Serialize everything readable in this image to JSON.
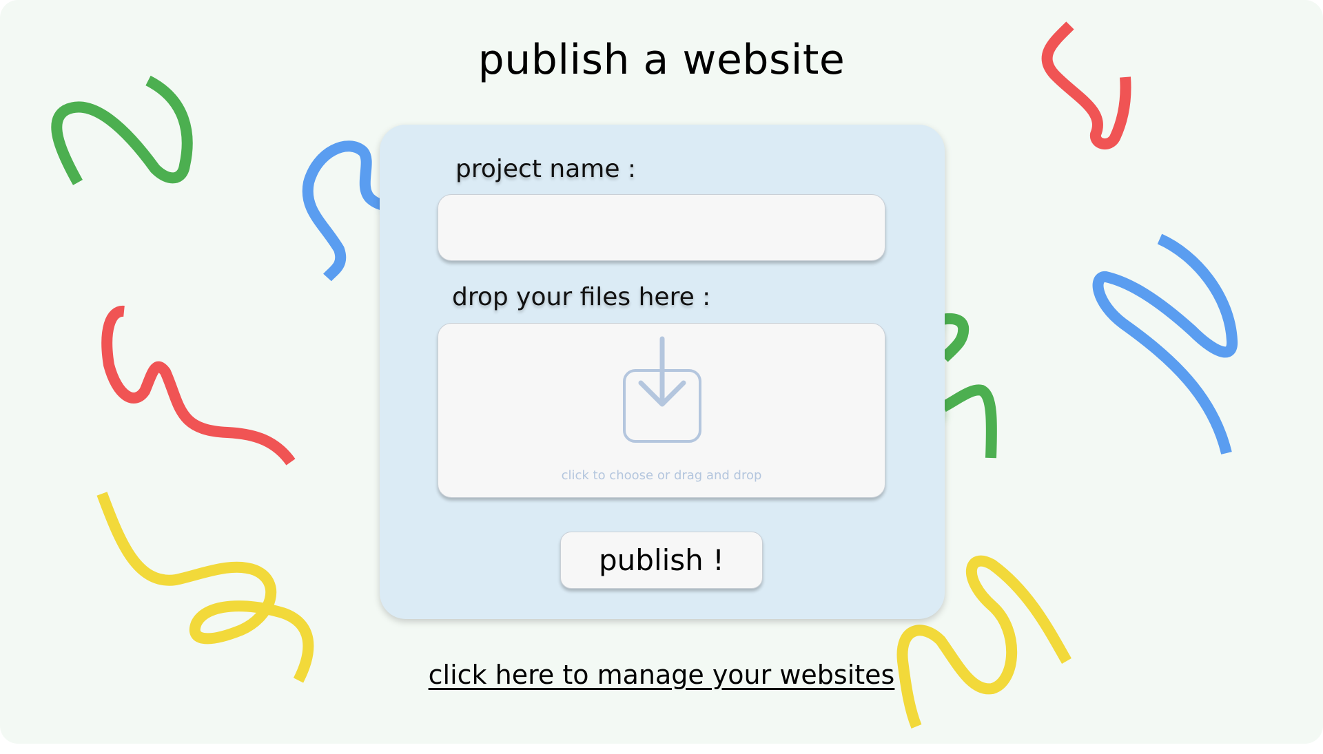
{
  "page": {
    "title": "publish a website"
  },
  "form": {
    "project_name_label": "project name :",
    "project_name_value": "",
    "project_name_placeholder": "",
    "files_label": "drop your files here :",
    "dropzone_hint": "click to choose or drag and drop",
    "dropzone_icon": "download-tray-icon",
    "publish_label": "publish !"
  },
  "footer": {
    "manage_link_label": "click here to manage your websites"
  },
  "colors": {
    "background": "#f3f9f4",
    "card": "#dbebf5",
    "green": "#4caf50",
    "red": "#f05454",
    "blue": "#5a9df0",
    "yellow": "#f2d93a",
    "icon": "#b4c6de"
  }
}
